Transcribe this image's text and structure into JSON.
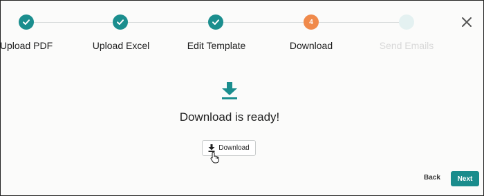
{
  "stepper": {
    "steps": [
      {
        "label": "Upload PDF",
        "state": "completed"
      },
      {
        "label": "Upload Excel",
        "state": "completed"
      },
      {
        "label": "Edit Template",
        "state": "completed"
      },
      {
        "label": "Download",
        "state": "current",
        "number": "4"
      },
      {
        "label": "Send Emails",
        "state": "pending"
      }
    ]
  },
  "icons": {
    "close": "close-icon",
    "check": "checkmark-icon",
    "download": "download-icon",
    "cursor": "hand-pointer-cursor-icon"
  },
  "main": {
    "status_text": "Download is ready!",
    "download_button_label": "Download"
  },
  "footer": {
    "back_label": "Back",
    "next_label": "Next"
  },
  "colors": {
    "accent": "#1b8e8e",
    "current_step": "#f08a4b",
    "pending_step": "#e4f1f1"
  }
}
